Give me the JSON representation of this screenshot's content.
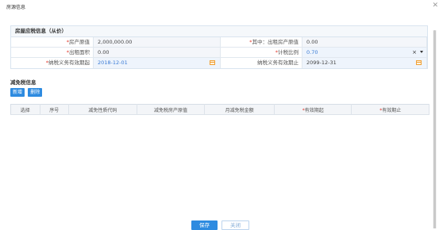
{
  "window": {
    "title": "房源信息",
    "close_icon": "close-icon"
  },
  "section1": {
    "title": "房屋应税信息（从价）",
    "rows": [
      {
        "label1": "房产原值",
        "required1": "*",
        "value1": "2,000,000.00",
        "label2": "其中：出租房产原值",
        "required2": "*",
        "value2": "0.00"
      },
      {
        "label1": "出租面积",
        "required1": "*",
        "value1": "0.00",
        "label2": "计税比例",
        "required2": "*",
        "value2": "0.70"
      },
      {
        "label1": "纳税义务有效期起",
        "required1": "*",
        "value1": "2018-12-01",
        "label2": "纳税义务有效期止",
        "required2": "",
        "value2": "2099-12-31"
      }
    ]
  },
  "section2": {
    "title": "减免税信息",
    "add_label": "新增",
    "delete_label": "删除",
    "columns": [
      {
        "label": "选择",
        "required": ""
      },
      {
        "label": "序号",
        "required": ""
      },
      {
        "label": "减免性质代码",
        "required": ""
      },
      {
        "label": "减免税房产原值",
        "required": ""
      },
      {
        "label": "月减免税金额",
        "required": ""
      },
      {
        "label": "有效期起",
        "required": "*"
      },
      {
        "label": "有效期止",
        "required": "*"
      }
    ]
  },
  "footer": {
    "save_label": "保存",
    "close_label": "关闭"
  },
  "colors": {
    "primary": "#2e8be0",
    "required": "#e3392d",
    "calendar": "#f0a036"
  }
}
